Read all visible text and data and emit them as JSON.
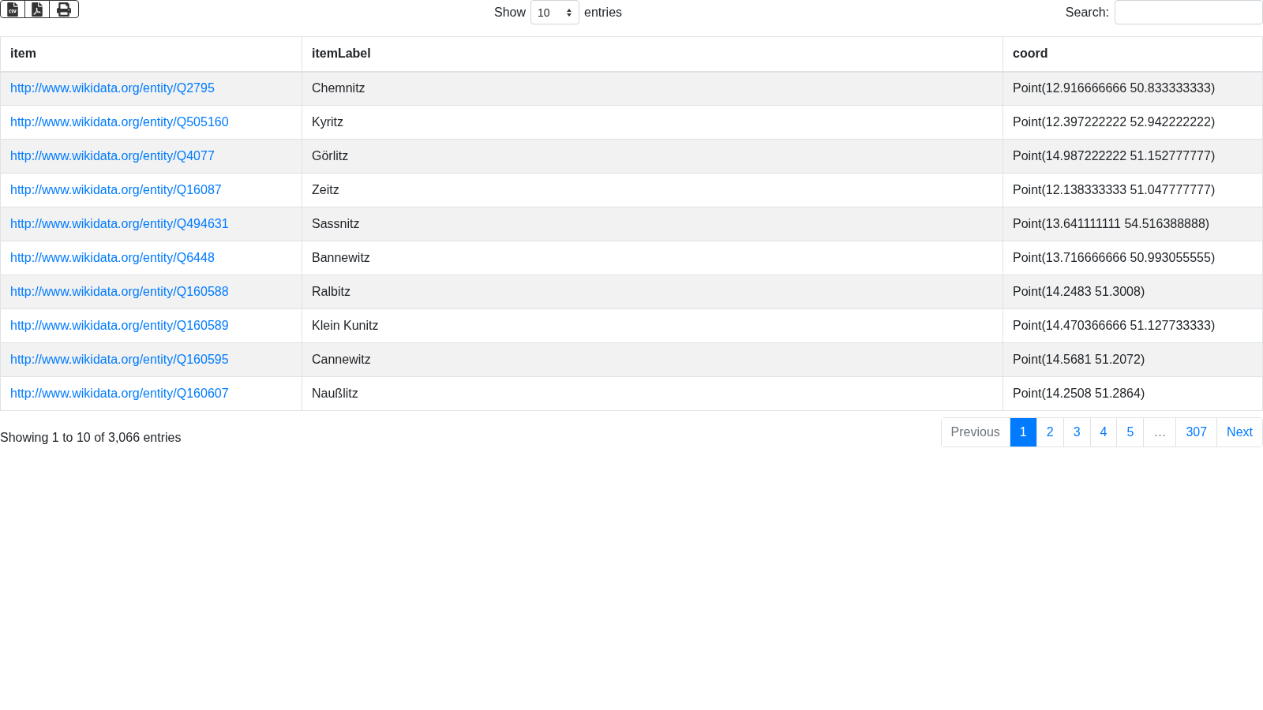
{
  "toolbar": {
    "show_label": "Show",
    "page_size": "10",
    "entries_label": "entries",
    "search_label": "Search:"
  },
  "table": {
    "columns": [
      "item",
      "itemLabel",
      "coord"
    ],
    "rows": [
      {
        "item": "http://www.wikidata.org/entity/Q2795",
        "itemLabel": "Chemnitz",
        "coord": "Point(12.916666666 50.833333333)"
      },
      {
        "item": "http://www.wikidata.org/entity/Q505160",
        "itemLabel": "Kyritz",
        "coord": "Point(12.397222222 52.942222222)"
      },
      {
        "item": "http://www.wikidata.org/entity/Q4077",
        "itemLabel": "Görlitz",
        "coord": "Point(14.987222222 51.152777777)"
      },
      {
        "item": "http://www.wikidata.org/entity/Q16087",
        "itemLabel": "Zeitz",
        "coord": "Point(12.138333333 51.047777777)"
      },
      {
        "item": "http://www.wikidata.org/entity/Q494631",
        "itemLabel": "Sassnitz",
        "coord": "Point(13.641111111 54.516388888)"
      },
      {
        "item": "http://www.wikidata.org/entity/Q6448",
        "itemLabel": "Bannewitz",
        "coord": "Point(13.716666666 50.993055555)"
      },
      {
        "item": "http://www.wikidata.org/entity/Q160588",
        "itemLabel": "Ralbitz",
        "coord": "Point(14.2483 51.3008)"
      },
      {
        "item": "http://www.wikidata.org/entity/Q160589",
        "itemLabel": "Klein Kunitz",
        "coord": "Point(14.470366666 51.127733333)"
      },
      {
        "item": "http://www.wikidata.org/entity/Q160595",
        "itemLabel": "Cannewitz",
        "coord": "Point(14.5681 51.2072)"
      },
      {
        "item": "http://www.wikidata.org/entity/Q160607",
        "itemLabel": "Naußlitz",
        "coord": "Point(14.2508 51.2864)"
      }
    ]
  },
  "info": "Showing 1 to 10 of 3,066 entries",
  "pagination": [
    {
      "label": "Previous",
      "selected": false,
      "disabled": true
    },
    {
      "label": "1",
      "selected": true,
      "disabled": false
    },
    {
      "label": "2",
      "selected": false,
      "disabled": false
    },
    {
      "label": "3",
      "selected": false,
      "disabled": false
    },
    {
      "label": "4",
      "selected": false,
      "disabled": false
    },
    {
      "label": "5",
      "selected": false,
      "disabled": false
    },
    {
      "label": "…",
      "selected": false,
      "disabled": true
    },
    {
      "label": "307",
      "selected": false,
      "disabled": false
    },
    {
      "label": "Next",
      "selected": false,
      "disabled": false
    }
  ]
}
